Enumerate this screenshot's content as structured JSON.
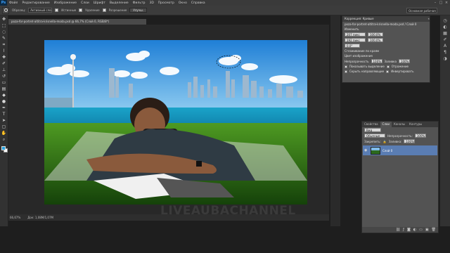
{
  "menubar": {
    "logo": "Ps",
    "items": [
      "Файл",
      "Редактирование",
      "Изображение",
      "Слои",
      "Шрифт",
      "Выделение",
      "Фильтр",
      "3D",
      "Просмотр",
      "Окно",
      "Справка"
    ]
  },
  "options": {
    "sample_label": "Образец:",
    "sample_value": "Активный слой",
    "checkbox1": "Истинные",
    "checkbox2": "Удаление",
    "checkbox3": "Разрешение",
    "button": "Улучш.",
    "workspace": "Основная рабочая среда"
  },
  "document": {
    "tab": "poza-for-portret-altitra-krisnella-moda.psd @ 66,7% (Слой 0, RGB/8*)",
    "zoom": "66,67%",
    "doc_size": "Док: 1,08М/1,07М"
  },
  "character": {
    "title": "Коррекция: Кривые",
    "name": "poza-for-portret-altitra-krisnella-moda.psd / Слой 0",
    "instr": "Изменить",
    "fields": [
      "207 пикс",
      "192 пикс",
      "0,0°"
    ],
    "pct": [
      "100,0%",
      "100,0%"
    ],
    "row_label1": "Сглаживание по краям",
    "row_label2": "Цвет изображения",
    "row_label3": "Непрозрачность",
    "row_value3": "100%",
    "row_label4": "Заливка",
    "row_value4": "100%",
    "check_labels": [
      "Показывать выделение",
      "Отражение",
      "Скрыть направляющие",
      "Инвертировать"
    ]
  },
  "layers": {
    "tabs": [
      "Свойства",
      "Слои",
      "Каналы",
      "Контуры"
    ],
    "kind": "Вид",
    "blend": "Обычные",
    "opacity_label": "Непрозрачность:",
    "opacity": "100%",
    "lock_label": "Закрепить:",
    "fill_label": "Заливка:",
    "fill": "100%",
    "layer_name": "Слой 0"
  },
  "watermark": "LIVEAUBACHANNEL",
  "colors": {
    "foreground": "#2aa3e0",
    "background": "#ffffff"
  }
}
